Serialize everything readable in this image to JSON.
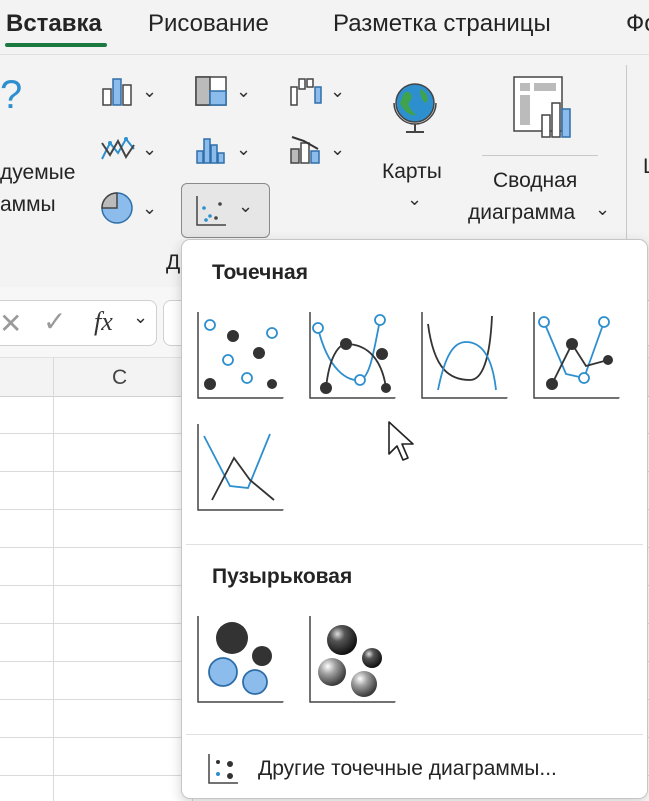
{
  "tabs": [
    {
      "label": "Вставка",
      "active": true
    },
    {
      "label": "Рисование"
    },
    {
      "label": "Разметка страницы"
    },
    {
      "label": "Фо"
    }
  ],
  "ribbon": {
    "recommended_partial_line1": "дуемые",
    "recommended_partial_line2": "аммы",
    "question_glyph": "?",
    "maps_label": "Карты",
    "pivot_line1": "Сводная",
    "pivot_line2": "диаграмма",
    "group_label_partial": "Д",
    "right_edge_partial": "Ш"
  },
  "formula_bar": {
    "fx_label": "fx"
  },
  "grid": {
    "column_c": "C"
  },
  "dropdown": {
    "scatter_title": "Точечная",
    "bubble_title": "Пузырьковая",
    "more_label": "Другие точечные диаграммы..."
  },
  "colors": {
    "accent_green": "#1b7a40",
    "chart_blue": "#2e8fcf",
    "chart_dark": "#333333",
    "bubble_blue": "#8bbcec"
  }
}
